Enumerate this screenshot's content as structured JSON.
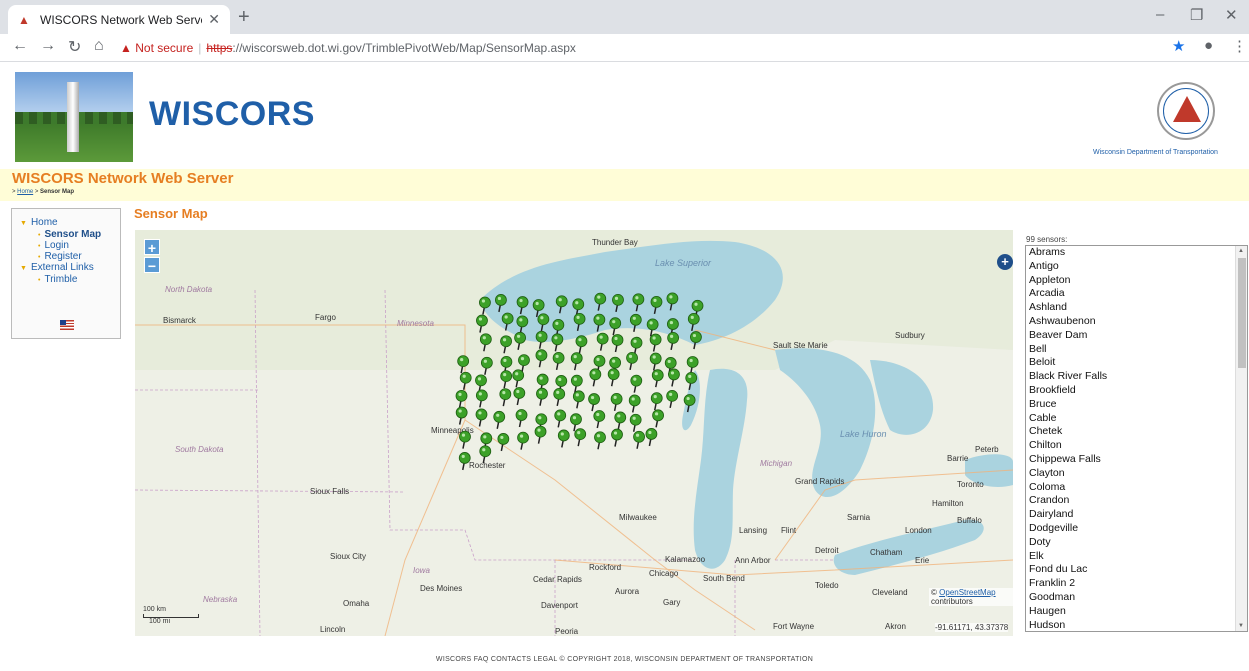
{
  "browser": {
    "tab_title": "WISCORS Network Web Server -",
    "url_warning": "Not secure",
    "url_scheme": "https",
    "url_rest": "://wiscorsweb.dot.wi.gov/TrimblePivotWeb/Map/SensorMap.aspx"
  },
  "header": {
    "logo_text": "WISCORS",
    "dot_name": "Wisconsin Department of Transportation",
    "site_title": "WISCORS Network Web Server",
    "breadcrumb_home": "Home",
    "breadcrumb_current": "Sensor Map"
  },
  "nav": {
    "home": "Home",
    "sensor_map": "Sensor Map",
    "login": "Login",
    "register": "Register",
    "external_links": "External Links",
    "trimble": "Trimble"
  },
  "map": {
    "title": "Sensor Map",
    "zoom_in": "+",
    "zoom_out": "−",
    "scale_km": "100 km",
    "scale_mi": "100 mi",
    "attribution_prefix": "©",
    "attribution_link": "OpenStreetMap",
    "attribution_suffix": "contributors",
    "coords": "-91.61171, 43.37378",
    "labels": [
      {
        "text": "North Dakota",
        "cls": "st"
      },
      {
        "text": "Bismarck",
        "cls": ""
      },
      {
        "text": "Fargo",
        "cls": ""
      },
      {
        "text": "Minnesota",
        "cls": "st"
      },
      {
        "text": "Thunder Bay",
        "cls": ""
      },
      {
        "text": "Lake Superior",
        "cls": "it"
      },
      {
        "text": "Sault Ste Marie",
        "cls": ""
      },
      {
        "text": "Sudbury",
        "cls": ""
      },
      {
        "text": "Minneapolis",
        "cls": ""
      },
      {
        "text": "South Dakota",
        "cls": "st"
      },
      {
        "text": "Rochester",
        "cls": ""
      },
      {
        "text": "Lake Huron",
        "cls": "it"
      },
      {
        "text": "Michigan",
        "cls": "st"
      },
      {
        "text": "Barrie",
        "cls": ""
      },
      {
        "text": "Toronto",
        "cls": ""
      },
      {
        "text": "Sioux Falls",
        "cls": ""
      },
      {
        "text": "Grand Rapids",
        "cls": ""
      },
      {
        "text": "Milwaukee",
        "cls": ""
      },
      {
        "text": "Sarnia",
        "cls": ""
      },
      {
        "text": "Hamilton",
        "cls": ""
      },
      {
        "text": "Buffalo",
        "cls": ""
      },
      {
        "text": "Lansing",
        "cls": ""
      },
      {
        "text": "Flint",
        "cls": ""
      },
      {
        "text": "London",
        "cls": ""
      },
      {
        "text": "Detroit",
        "cls": ""
      },
      {
        "text": "Chatham",
        "cls": ""
      },
      {
        "text": "Sioux City",
        "cls": ""
      },
      {
        "text": "Iowa",
        "cls": "st"
      },
      {
        "text": "Rockford",
        "cls": ""
      },
      {
        "text": "Kalamazoo",
        "cls": ""
      },
      {
        "text": "Ann Arbor",
        "cls": ""
      },
      {
        "text": "Erie",
        "cls": ""
      },
      {
        "text": "Des Moines",
        "cls": ""
      },
      {
        "text": "Cedar Rapids",
        "cls": ""
      },
      {
        "text": "Chicago",
        "cls": ""
      },
      {
        "text": "South Bend",
        "cls": ""
      },
      {
        "text": "Toledo",
        "cls": ""
      },
      {
        "text": "Cleveland",
        "cls": ""
      },
      {
        "text": "Nebraska",
        "cls": "st"
      },
      {
        "text": "Omaha",
        "cls": ""
      },
      {
        "text": "Davenport",
        "cls": ""
      },
      {
        "text": "Aurora",
        "cls": ""
      },
      {
        "text": "Gary",
        "cls": ""
      },
      {
        "text": "Lincoln",
        "cls": ""
      },
      {
        "text": "Peoria",
        "cls": ""
      },
      {
        "text": "Fort Wayne",
        "cls": ""
      },
      {
        "text": "Akron",
        "cls": ""
      },
      {
        "text": "Peterb",
        "cls": ""
      }
    ]
  },
  "sensors": {
    "count_label": "99 sensors:",
    "visible": [
      "Abrams",
      "Antigo",
      "Appleton",
      "Arcadia",
      "Ashland",
      "Ashwaubenon",
      "Beaver Dam",
      "Bell",
      "Beloit",
      "Black River Falls",
      "Brookfield",
      "Bruce",
      "Cable",
      "Chetek",
      "Chilton",
      "Chippewa Falls",
      "Clayton",
      "Coloma",
      "Crandon",
      "Dairyland",
      "Dodgeville",
      "Doty",
      "Elk",
      "Fond du Lac",
      "Franklin 2",
      "Goodman",
      "Haugen",
      "Hudson"
    ]
  },
  "footer": "WISCORS FAQ  CONTACTS  LEGAL  © COPYRIGHT 2018, WISCONSIN DEPARTMENT OF TRANSPORTATION",
  "colors": {
    "accent_orange": "#e67e22",
    "link_blue": "#1f5fa8",
    "marker_green": "#3ca128",
    "water": "#aad3df"
  }
}
